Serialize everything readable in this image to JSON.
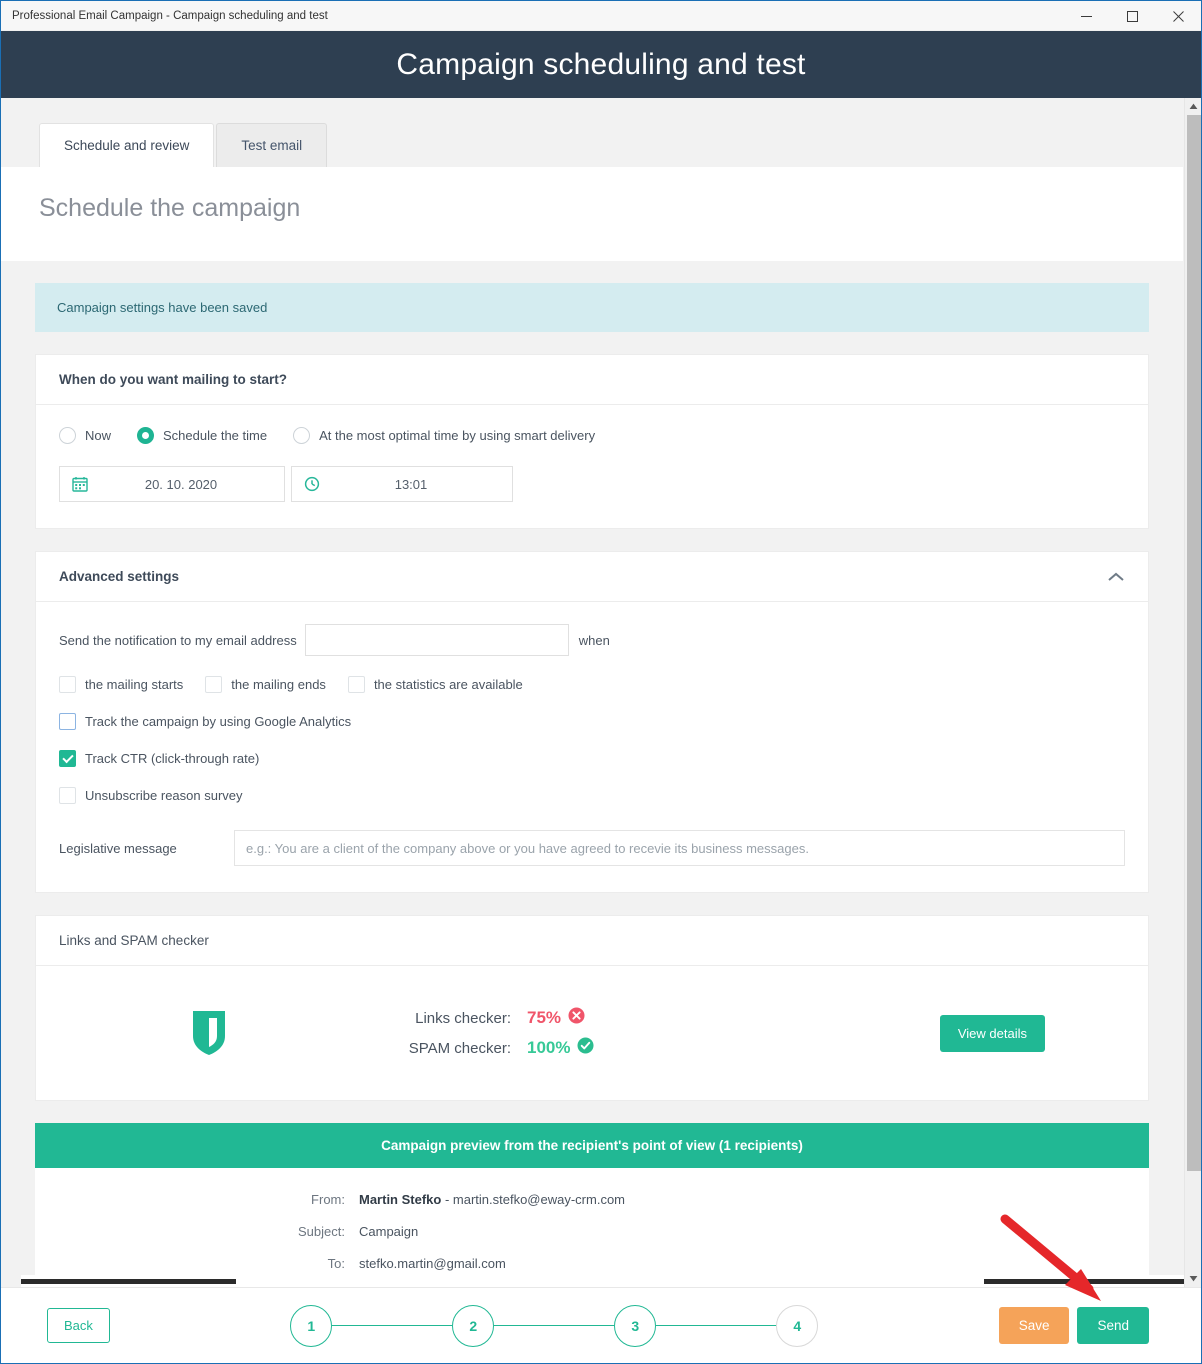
{
  "window": {
    "title": "Professional Email Campaign - Campaign scheduling and test",
    "controls": {
      "minimize": "minimize-icon",
      "maximize": "maximize-icon",
      "close": "close-icon"
    }
  },
  "header": {
    "title": "Campaign scheduling and test"
  },
  "tabs": [
    {
      "label": "Schedule and review",
      "active": true
    },
    {
      "label": "Test email",
      "active": false
    }
  ],
  "page": {
    "title": "Schedule the campaign"
  },
  "alert": {
    "message": "Campaign settings have been saved"
  },
  "schedule": {
    "heading": "When do you want mailing to start?",
    "options": [
      {
        "label": "Now",
        "selected": false
      },
      {
        "label": "Schedule the time",
        "selected": true
      },
      {
        "label": "At the most optimal time by using smart delivery",
        "selected": false
      }
    ],
    "date": {
      "icon": "calendar-icon",
      "value": "20. 10. 2020"
    },
    "time": {
      "icon": "clock-icon",
      "value": "13:01"
    }
  },
  "advanced": {
    "heading": "Advanced settings",
    "collapse_icon": "chevron-up-icon",
    "notification_label": "Send the notification to my email address",
    "notification_value": "",
    "notification_placeholder": "",
    "when_label": "when",
    "when_options": [
      {
        "label": "the mailing starts",
        "checked": false
      },
      {
        "label": "the mailing ends",
        "checked": false
      },
      {
        "label": "the statistics are available",
        "checked": false
      }
    ],
    "toggles": [
      {
        "label": "Track the campaign by using Google Analytics",
        "checked": false,
        "focused": true
      },
      {
        "label": "Track CTR (click-through rate)",
        "checked": true,
        "focused": false
      },
      {
        "label": "Unsubscribe reason survey",
        "checked": false,
        "focused": false
      }
    ],
    "legislative_label": "Legislative message",
    "legislative_value": "",
    "legislative_placeholder": "e.g.: You are a client of the company above or you have agreed to recevie its business messages."
  },
  "checker": {
    "heading": "Links and SPAM checker",
    "shield_icon": "shield-icon",
    "links": {
      "label": "Links checker:",
      "value": "75%",
      "status": "fail",
      "status_icon": "error-circle-icon"
    },
    "spam": {
      "label": "SPAM checker:",
      "value": "100%",
      "status": "ok",
      "status_icon": "check-circle-icon"
    },
    "view_details": "View details"
  },
  "preview": {
    "heading": "Campaign preview from the recipient's point of view (1 recipients)",
    "rows": [
      {
        "key": "From:",
        "name": "Martin Stefko",
        "rest": " - martin.stefko@eway-crm.com"
      },
      {
        "key": "Subject:",
        "name": "",
        "rest": "Campaign"
      },
      {
        "key": "To:",
        "name": "",
        "rest": "stefko.martin@gmail.com"
      }
    ]
  },
  "footer": {
    "back": "Back",
    "steps": [
      {
        "label": "1",
        "active": true
      },
      {
        "label": "2",
        "active": true
      },
      {
        "label": "3",
        "active": true
      },
      {
        "label": "4",
        "active": false
      }
    ],
    "save": "Save",
    "send": "Send"
  },
  "colors": {
    "brand_green": "#21b894",
    "header_navy": "#2e3f51",
    "alert_bg": "#d4ecf0",
    "save_orange": "#f5a359",
    "fail_red": "#f0556a",
    "ok_green": "#37c997",
    "annotation_red": "#e5272a"
  }
}
